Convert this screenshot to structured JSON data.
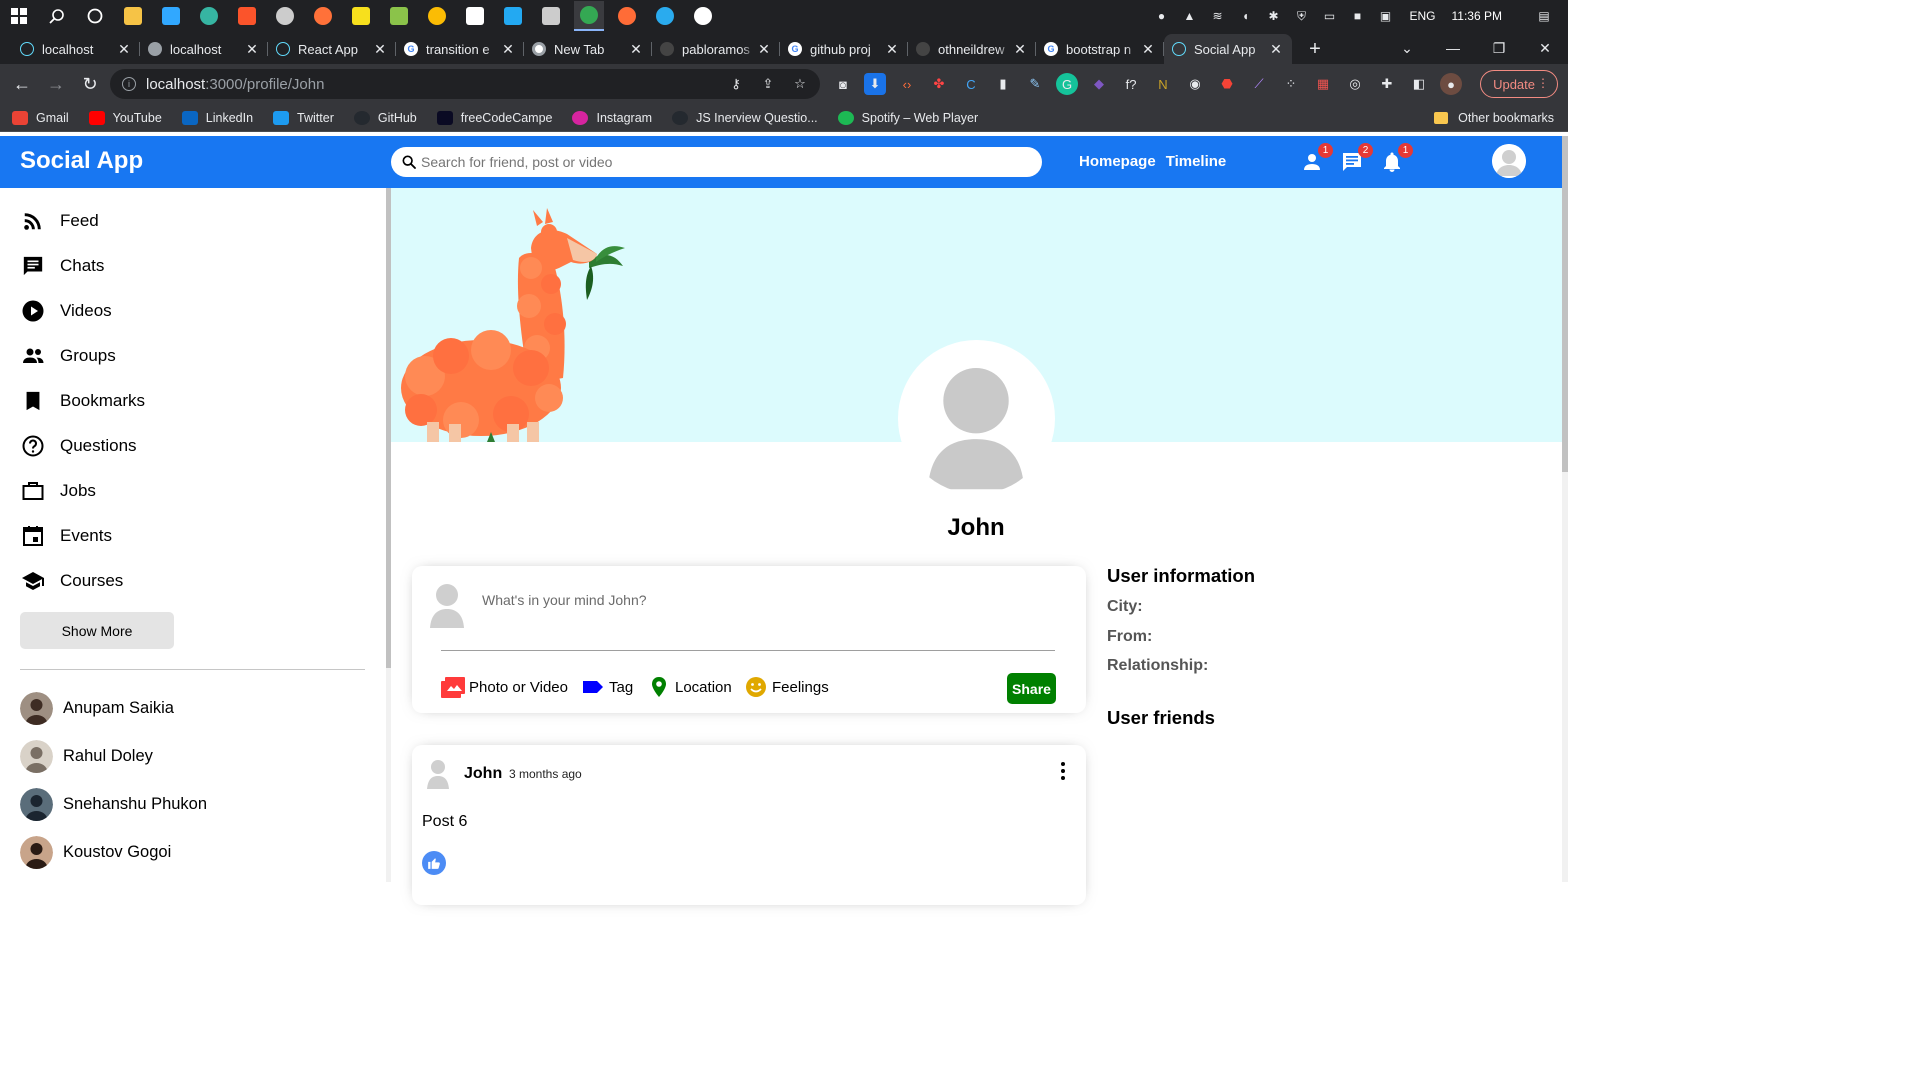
{
  "taskbar": {
    "apps": [
      {
        "icon": "windows-start-icon",
        "color": "#ffffff"
      },
      {
        "icon": "search-icon",
        "color": "#ffffff"
      },
      {
        "icon": "task-view-icon",
        "color": "#ffffff"
      },
      {
        "icon": "file-explorer-icon",
        "color": "#f6c346"
      },
      {
        "icon": "photoshop-icon",
        "color": "#31a8ff"
      },
      {
        "icon": "edge-icon",
        "color": "#36b5a2"
      },
      {
        "icon": "brave-icon",
        "color": "#fb542b"
      },
      {
        "icon": "obs-icon",
        "color": "#cccccc"
      },
      {
        "icon": "firefox-icon",
        "color": "#ff7139"
      },
      {
        "icon": "sticky-notes-icon",
        "color": "#f7e01d"
      },
      {
        "icon": "notepad-icon",
        "color": "#8bc34a"
      },
      {
        "icon": "chrome-icon",
        "color": "#fbbc04"
      },
      {
        "icon": "notion-icon",
        "color": "#ffffff"
      },
      {
        "icon": "vscode-icon",
        "color": "#23a9f2"
      },
      {
        "icon": "terminal-icon",
        "color": "#cccccc"
      },
      {
        "icon": "chrome-active-icon",
        "color": "#34a853"
      },
      {
        "icon": "postman-icon",
        "color": "#ff6c37"
      },
      {
        "icon": "telegram-icon",
        "color": "#2aabee"
      },
      {
        "icon": "spotify-tray-icon",
        "color": "#ffffff"
      }
    ],
    "tray": {
      "language": "ENG",
      "time": "11:36 PM"
    }
  },
  "browser": {
    "tabs": [
      {
        "label": "localhost",
        "favicon": "react-icon",
        "active": false
      },
      {
        "label": "localhost",
        "favicon": "globe-icon",
        "active": false
      },
      {
        "label": "React App",
        "favicon": "react-icon",
        "active": false
      },
      {
        "label": "transition e",
        "favicon": "google-icon",
        "active": false
      },
      {
        "label": "New Tab",
        "favicon": "chrome-icon",
        "active": false
      },
      {
        "label": "pabloramos",
        "favicon": "github-icon",
        "active": false
      },
      {
        "label": "github proj",
        "favicon": "google-icon",
        "active": false
      },
      {
        "label": "othneildrew",
        "favicon": "github-icon",
        "active": false
      },
      {
        "label": "bootstrap n",
        "favicon": "google-icon",
        "active": false
      },
      {
        "label": "Social App",
        "favicon": "react-icon",
        "active": true
      }
    ],
    "url_host": "localhost",
    "url_path": ":3000/profile/John",
    "update_label": "Update",
    "bookmarks": [
      {
        "label": "Gmail",
        "icon": "gmail-icon",
        "color": "#ea4335"
      },
      {
        "label": "YouTube",
        "icon": "youtube-icon",
        "color": "#ff0000"
      },
      {
        "label": "LinkedIn",
        "icon": "linkedin-icon",
        "color": "#0a66c2"
      },
      {
        "label": "Twitter",
        "icon": "twitter-icon",
        "color": "#1d9bf0"
      },
      {
        "label": "GitHub",
        "icon": "github-icon",
        "color": "#24292f"
      },
      {
        "label": "freeCodeCampe",
        "icon": "freecodecamp-icon",
        "color": "#0a0a23"
      },
      {
        "label": "Instagram",
        "icon": "instagram-icon",
        "color": "#d6249f"
      },
      {
        "label": "JS Inerview Questio...",
        "icon": "github-icon",
        "color": "#24292f"
      },
      {
        "label": "Spotify – Web Player",
        "icon": "spotify-icon",
        "color": "#1db954"
      }
    ],
    "other_bookmarks": "Other bookmarks"
  },
  "app": {
    "logo": "Social App",
    "search_placeholder": "Search for friend, post or video",
    "nav_links": [
      "Homepage",
      "Timeline"
    ],
    "badges": {
      "friends": "1",
      "messages": "2",
      "notifications": "1"
    },
    "brand_color": "#1877f2"
  },
  "sidebar": {
    "items": [
      {
        "label": "Feed",
        "icon": "rss-feed-icon"
      },
      {
        "label": "Chats",
        "icon": "chat-icon"
      },
      {
        "label": "Videos",
        "icon": "play-circle-icon"
      },
      {
        "label": "Groups",
        "icon": "group-icon"
      },
      {
        "label": "Bookmarks",
        "icon": "bookmark-icon"
      },
      {
        "label": "Questions",
        "icon": "help-outline-icon"
      },
      {
        "label": "Jobs",
        "icon": "work-outline-icon"
      },
      {
        "label": "Events",
        "icon": "event-icon"
      },
      {
        "label": "Courses",
        "icon": "school-icon"
      }
    ],
    "show_more": "Show More",
    "friends": [
      {
        "name": "Anupam Saikia"
      },
      {
        "name": "Rahul Doley"
      },
      {
        "name": "Snehanshu Phukon"
      },
      {
        "name": "Koustov Gogoi"
      }
    ]
  },
  "profile": {
    "name": "John",
    "cover_color": "#dcfbfd"
  },
  "share": {
    "placeholder": "What's in your mind John?",
    "options": [
      {
        "label": "Photo or Video",
        "icon": "perm-media-icon",
        "color": "#ff3b3b"
      },
      {
        "label": "Tag",
        "icon": "label-icon",
        "color": "#0000ff"
      },
      {
        "label": "Location",
        "icon": "room-icon",
        "color": "#008000"
      },
      {
        "label": "Feelings",
        "icon": "emoji-emotions-icon",
        "color": "#e0a800"
      }
    ],
    "button": "Share",
    "button_color": "#008000"
  },
  "post": {
    "author": "John",
    "time": "3 months ago",
    "text": "Post 6",
    "like_color": "#4c8cf5"
  },
  "right": {
    "user_info_title": "User information",
    "rows": [
      {
        "label": "City:"
      },
      {
        "label": "From:"
      },
      {
        "label": "Relationship:"
      }
    ],
    "friends_title": "User friends"
  }
}
